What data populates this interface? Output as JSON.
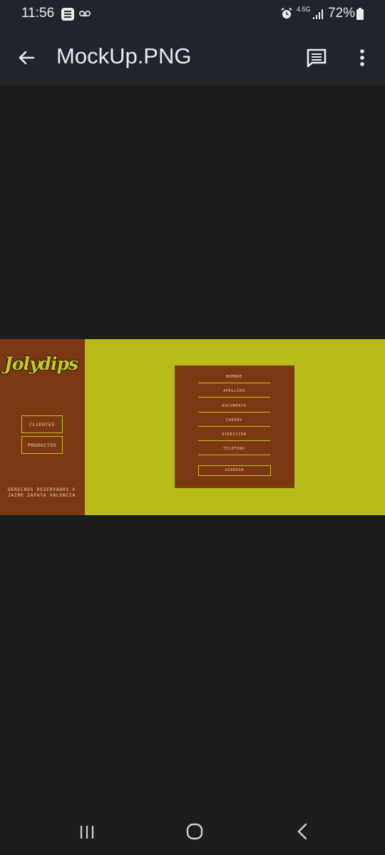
{
  "status_bar": {
    "time": "11:56",
    "network": "4.5G",
    "battery": "72%",
    "icons": [
      "app-notification-icon",
      "voicemail-icon",
      "alarm-icon",
      "signal-icon",
      "battery-icon"
    ]
  },
  "app_bar": {
    "title": "MockUp.PNG",
    "icons": [
      "back-arrow-icon",
      "comment-icon",
      "more-vert-icon"
    ]
  },
  "mockup": {
    "logo": "Jolydips",
    "nav": [
      "CLIENTES",
      "PRODUCTOS"
    ],
    "footer_line1": "DERECHOS RESERVADOS ©",
    "footer_line2": "JAIME ZAPATA VALENCIA",
    "fields": [
      "NOMBRE",
      "APELLIDO",
      "DOCUMENTO",
      "CORREO",
      "DIRECCIÓN",
      "TELEFONO"
    ],
    "save_label": "GUARDAR",
    "colors": {
      "background": "#b8bc18",
      "panel": "#7c3812",
      "accent": "#c8c21a"
    }
  },
  "nav_bar": {
    "icons": [
      "recents-icon",
      "home-icon",
      "back-icon"
    ]
  }
}
